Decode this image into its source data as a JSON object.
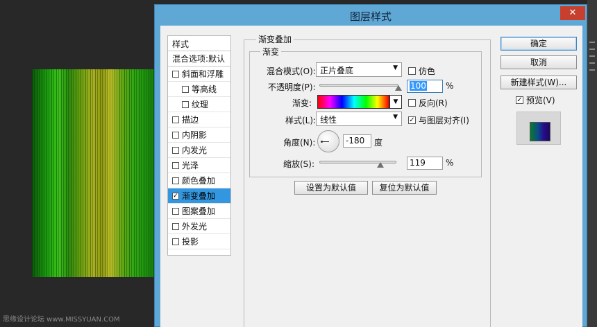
{
  "watermark": "思缘设计论坛 www.MISSYUAN.COM",
  "dialog": {
    "title": "图层样式",
    "close_symbol": "✕"
  },
  "style_list": {
    "header": "样式",
    "items": [
      {
        "label": "混合选项:默认",
        "checkbox": false,
        "checked": false
      },
      {
        "label": "斜面和浮雕",
        "checkbox": true,
        "checked": false
      },
      {
        "label": "等高线",
        "checkbox": true,
        "checked": false
      },
      {
        "label": "纹理",
        "checkbox": true,
        "checked": false
      },
      {
        "label": "描边",
        "checkbox": true,
        "checked": false
      },
      {
        "label": "内阴影",
        "checkbox": true,
        "checked": false
      },
      {
        "label": "内发光",
        "checkbox": true,
        "checked": false
      },
      {
        "label": "光泽",
        "checkbox": true,
        "checked": false
      },
      {
        "label": "颜色叠加",
        "checkbox": true,
        "checked": false
      },
      {
        "label": "渐变叠加",
        "checkbox": true,
        "checked": true,
        "selected": true
      },
      {
        "label": "图案叠加",
        "checkbox": true,
        "checked": false
      },
      {
        "label": "外发光",
        "checkbox": true,
        "checked": false
      },
      {
        "label": "投影",
        "checkbox": true,
        "checked": false
      }
    ]
  },
  "gradient_overlay": {
    "group_title": "渐变叠加",
    "subgroup_title": "渐变",
    "blend_mode_label": "混合模式(O):",
    "blend_mode_value": "正片叠底",
    "dither_label": "仿色",
    "dither_checked": false,
    "opacity_label": "不透明度(P):",
    "opacity_value": "100",
    "opacity_unit": "%",
    "opacity_fraction": 1.0,
    "gradient_label": "渐变:",
    "reverse_label": "反向(R)",
    "reverse_checked": false,
    "style_label": "样式(L):",
    "style_value": "线性",
    "align_label": "与图层对齐(I)",
    "align_checked": true,
    "angle_label": "角度(N):",
    "angle_value": "-180",
    "angle_unit": "度",
    "scale_label": "缩放(S):",
    "scale_value": "119",
    "scale_unit": "%",
    "scale_fraction": 0.79,
    "make_default_label": "设置为默认值",
    "reset_default_label": "复位为默认值"
  },
  "side_buttons": {
    "ok_label": "确定",
    "cancel_label": "取消",
    "new_style_label": "新建样式(W)...",
    "preview_label": "预览(V)",
    "preview_checked": true
  },
  "colors": {
    "titlebar": "#5fa8d6",
    "selection": "#3396e0",
    "close": "#c7402e"
  },
  "icons": {
    "dropdown": "chevron-down-icon",
    "close": "close-icon",
    "check": "checkmark-icon"
  }
}
